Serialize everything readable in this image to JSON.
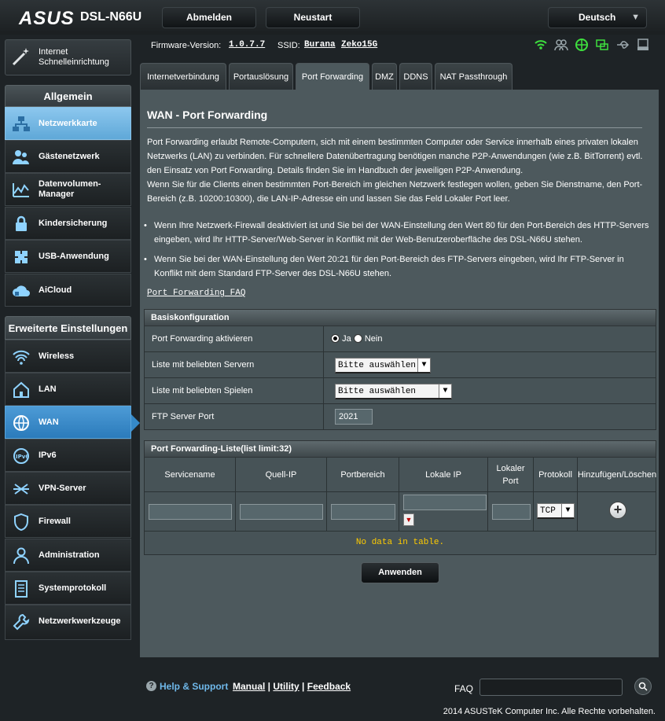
{
  "header": {
    "logo": "ASUS",
    "model": "DSL-N66U",
    "logout_label": "Abmelden",
    "reboot_label": "Neustart",
    "language": "Deutsch"
  },
  "status": {
    "firmware_label": "Firmware-Version:",
    "firmware_value": "1.0.7.7",
    "ssid_label": "SSID:",
    "ssid_1": "Burana",
    "ssid_2": "Zeko15G"
  },
  "sidebar": {
    "qis_label": "Internet Schnelleinrichtung",
    "general_heading": "Allgemein",
    "general_items": [
      {
        "label": "Netzwerkkarte",
        "icon": "network-map-icon"
      },
      {
        "label": "Gästenetzwerk",
        "icon": "guest-network-icon"
      },
      {
        "label": "Datenvolumen-Manager",
        "icon": "traffic-manager-icon"
      },
      {
        "label": "Kindersicherung",
        "icon": "parental-control-icon"
      },
      {
        "label": "USB-Anwendung",
        "icon": "usb-app-icon"
      },
      {
        "label": "AiCloud",
        "icon": "aicloud-icon"
      }
    ],
    "advanced_heading": "Erweiterte Einstellungen",
    "advanced_items": [
      {
        "label": "Wireless",
        "icon": "wireless-icon"
      },
      {
        "label": "LAN",
        "icon": "lan-icon"
      },
      {
        "label": "WAN",
        "icon": "wan-icon"
      },
      {
        "label": "IPv6",
        "icon": "ipv6-icon"
      },
      {
        "label": "VPN-Server",
        "icon": "vpn-icon"
      },
      {
        "label": "Firewall",
        "icon": "firewall-icon"
      },
      {
        "label": "Administration",
        "icon": "administration-icon"
      },
      {
        "label": "Systemprotokoll",
        "icon": "system-log-icon"
      },
      {
        "label": "Netzwerkwerkzeuge",
        "icon": "network-tools-icon"
      }
    ]
  },
  "tabs": [
    "Internetverbindung",
    "Portauslösung",
    "Port Forwarding",
    "DMZ",
    "DDNS",
    "NAT Passthrough"
  ],
  "main": {
    "title": "WAN - Port Forwarding",
    "description": "Port Forwarding erlaubt Remote-Computern, sich mit einem bestimmten Computer oder Service innerhalb eines privaten lokalen Netzwerks (LAN) zu verbinden. Für schnellere Datenübertragung benötigen manche P2P-Anwendungen (wie z.B. BitTorrent) evtl. den Einsatz von Port Forwarding. Details finden Sie im Handbuch der jeweiligen P2P-Anwendung.",
    "description2": "Wenn Sie für die Clients einen bestimmten Port-Bereich im gleichen Netzwerk festlegen wollen, geben Sie Dienstname, den Port-Bereich (z.B. 10200:10300), die LAN-IP-Adresse ein und lassen Sie das Feld Lokaler Port leer.",
    "bullet_1": "Wenn Ihre Netzwerk-Firewall deaktiviert ist und Sie bei der WAN-Einstellung den Wert 80 für den Port-Bereich des HTTP-Servers eingeben, wird Ihr HTTP-Server/Web-Server in Konflikt mit der Web-Benutzeroberfläche des DSL-N66U stehen.",
    "bullet_2": "Wenn Sie bei der WAN-Einstellung den Wert 20:21 für den Port-Bereich des FTP-Servers eingeben, wird Ihr FTP-Server in Konflikt mit dem Standard FTP-Server des DSL-N66U stehen.",
    "faq_link": "Port Forwarding FAQ"
  },
  "basic": {
    "heading": "Basiskonfiguration",
    "enable_label": "Port Forwarding aktivieren",
    "yes": "Ja",
    "no": "Nein",
    "servers_label": "Liste mit beliebten Servern",
    "servers_value": "Bitte auswählen",
    "games_label": "Liste mit beliebten Spielen",
    "games_value": "Bitte auswählen",
    "ftp_label": "FTP Server Port",
    "ftp_value": "2021"
  },
  "list": {
    "heading": "Port Forwarding-Liste(list limit:32)",
    "columns": [
      "Servicename",
      "Quell-IP",
      "Portbereich",
      "Lokale IP",
      "Lokaler Port",
      "Protokoll",
      "Hinzufügen/Löschen"
    ],
    "protocol_value": "TCP",
    "empty": "No data in table.",
    "apply": "Anwenden"
  },
  "footer": {
    "help": "Help & Support",
    "manual": "Manual",
    "utility": "Utility",
    "feedback": "Feedback",
    "faq": "FAQ",
    "copyright": "2014 ASUSTeK Computer Inc. Alle Rechte vorbehalten."
  }
}
